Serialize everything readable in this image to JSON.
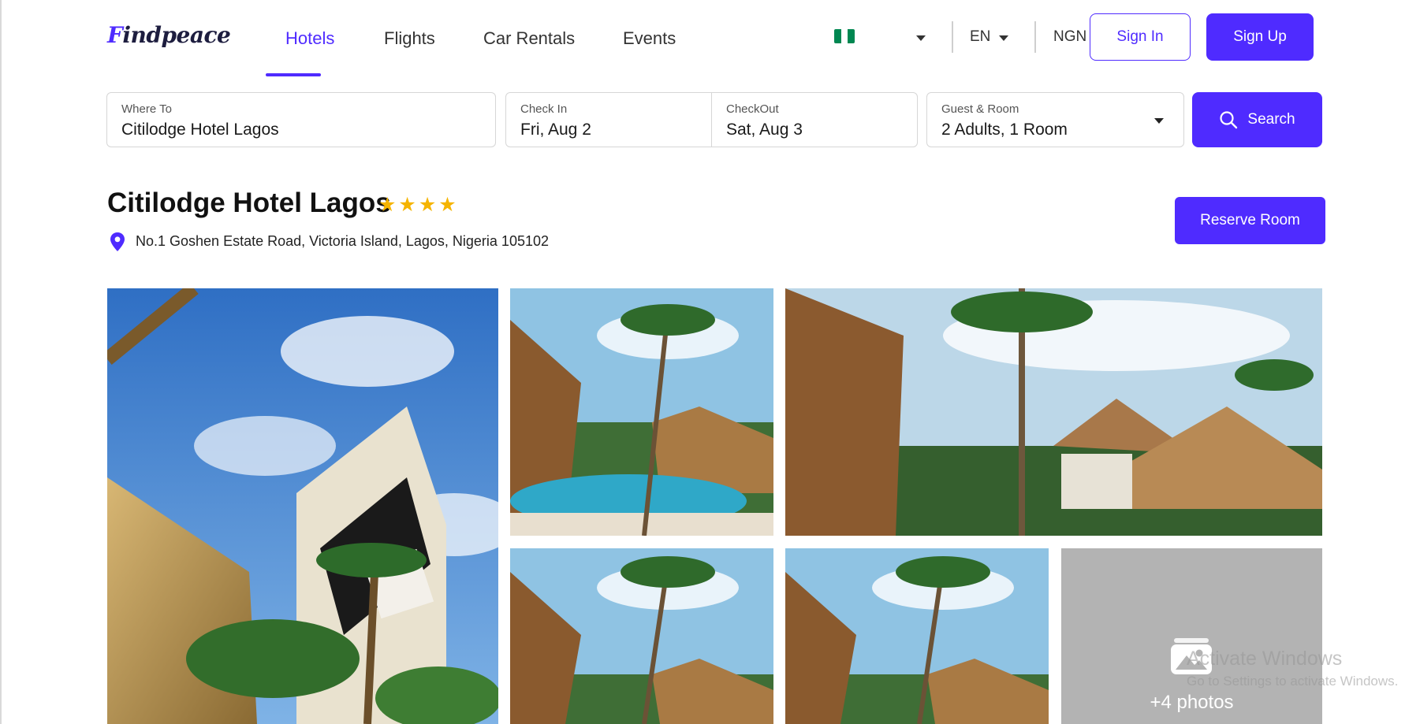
{
  "brand": {
    "logo_text": "Findpeace"
  },
  "nav": {
    "items": [
      {
        "label": "Hotels",
        "active": true
      },
      {
        "label": "Flights",
        "active": false
      },
      {
        "label": "Car Rentals",
        "active": false
      },
      {
        "label": "Events",
        "active": false
      }
    ]
  },
  "header": {
    "country_flag": "nigeria-flag-icon",
    "language": "EN",
    "currency": "NGN",
    "sign_in": "Sign In",
    "sign_up": "Sign Up"
  },
  "search": {
    "where_label": "Where To",
    "where_value": "Citilodge Hotel Lagos",
    "checkin_label": "Check In",
    "checkin_value": "Fri, Aug 2",
    "checkout_label": "CheckOut",
    "checkout_value": "Sat, Aug 3",
    "guest_label": "Guest & Room",
    "guest_value": "2 Adults, 1 Room",
    "button": "Search"
  },
  "hotel": {
    "name": "Citilodge Hotel Lagos",
    "rating_stars": 4,
    "address": "No.1 Goshen Estate Road, Victoria Island, Lagos, Nigeria 105102",
    "reserve_button": "Reserve Room"
  },
  "gallery": {
    "more_photos": "+4 photos"
  },
  "watermark": {
    "line1": "Activate Windows",
    "line2": "Go to Settings to activate Windows."
  },
  "colors": {
    "accent": "#4f2bff",
    "star": "#f5b400",
    "flag_green": "#008751",
    "more_tile": "#b3b3b3"
  }
}
